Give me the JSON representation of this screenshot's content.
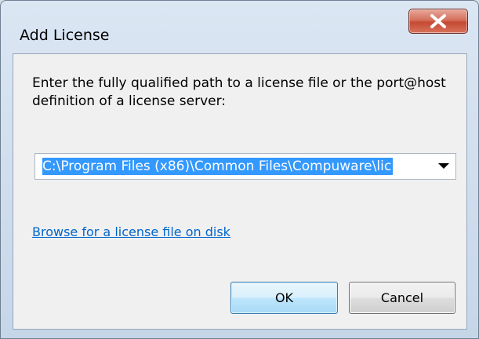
{
  "dialog": {
    "title": "Add License",
    "prompt": "Enter the fully qualified path to a license file or the port@host definition of a license server:",
    "path_value": "C:\\Program Files (x86)\\Common Files\\Compuware\\lic",
    "browse_link": "Browse for a license file on disk",
    "ok_label": "OK",
    "cancel_label": "Cancel"
  },
  "icons": {
    "close": "close-icon",
    "dropdown": "chevron-down-icon"
  },
  "colors": {
    "selection": "#3399ff",
    "link": "#0066cc",
    "close_button": "#c54a33",
    "default_button_border": "#3c7fb1"
  }
}
